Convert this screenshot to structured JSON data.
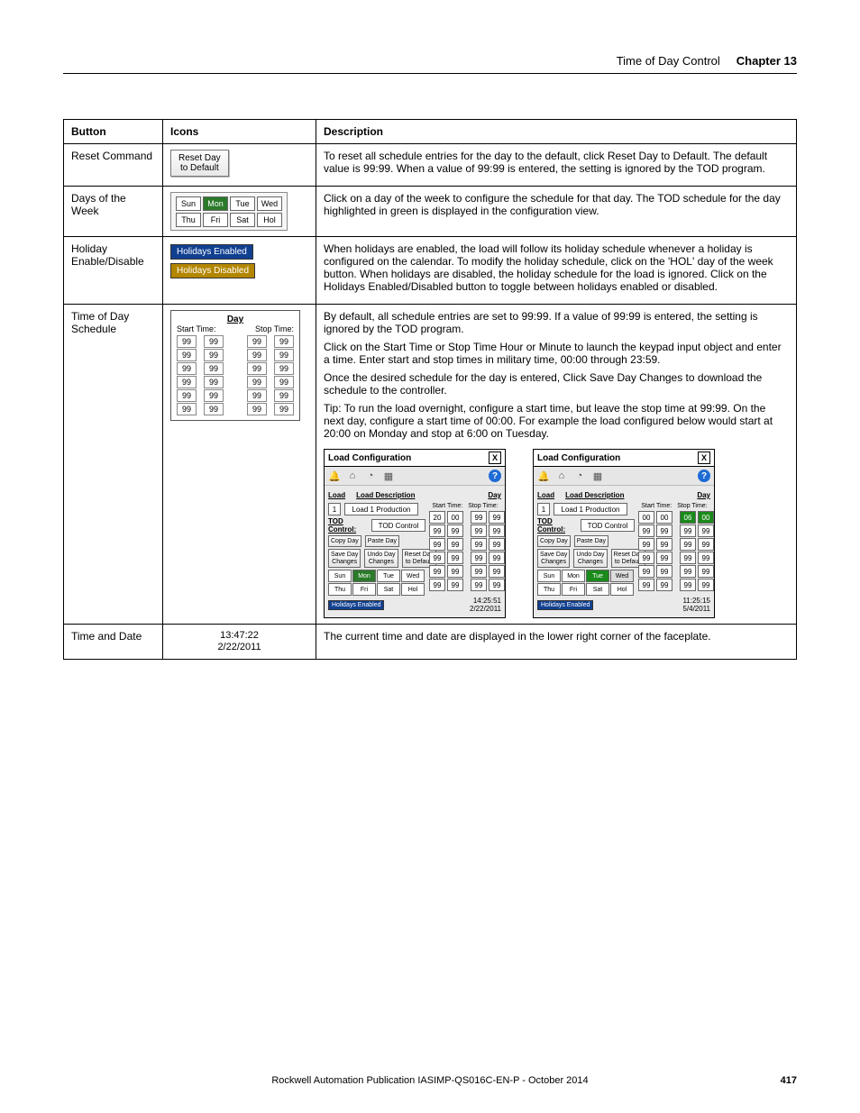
{
  "header": {
    "title": "Time of Day Control",
    "chapter": "Chapter 13"
  },
  "table": {
    "headers": {
      "button": "Button",
      "icons": "Icons",
      "description": "Description"
    }
  },
  "rows": {
    "reset": {
      "button": "Reset Command",
      "icon_label": "Reset Day\nto Default",
      "desc": "To reset all schedule entries for the day to the default, click Reset Day to Default. The default value is 99:99. When a value of 99:99 is entered, the setting is ignored by the TOD program."
    },
    "dow": {
      "button": "Days of the Week",
      "days_row1": [
        "Sun",
        "Mon",
        "Tue",
        "Wed"
      ],
      "days_row2": [
        "Thu",
        "Fri",
        "Sat",
        "Hol"
      ],
      "selected": "Mon",
      "desc": "Click on a day of the week to configure the schedule for that day. The TOD schedule for the day highlighted in green is displayed in the configuration view."
    },
    "hol": {
      "button": "Holiday Enable/Disable",
      "enabled_label": "Holidays Enabled",
      "disabled_label": "Holidays Disabled",
      "desc": "When holidays are enabled, the load will follow its holiday schedule whenever a holiday is configured on the calendar. To modify the holiday schedule, click on the 'HOL' day of the week button. When holidays are disabled, the holiday schedule for the load is ignored. Click on the Holidays Enabled/Disabled button to toggle between holidays enabled or disabled."
    },
    "sched": {
      "button": "Time of Day Schedule",
      "box": {
        "title": "Day",
        "start": "Start Time:",
        "stop": "Stop Time:",
        "rows": 6,
        "cell": "99"
      },
      "desc": [
        "By default, all schedule entries are set to 99:99. If a value of 99:99 is entered, the setting is ignored by the TOD program.",
        "Click on the Start Time or Stop Time Hour or Minute to launch the keypad input object and enter a time. Enter start and stop times in military time, 00:00 through 23:59.",
        "Once the desired schedule for the day is entered, Click Save Day Changes to download the schedule to the controller.",
        "Tip: To run the load overnight, configure a start time, but leave the stop time at 99:99. On the next day, configure a start time of 00:00. For example the load configured below would start at 20:00 on Monday and stop at 6:00 on Tuesday."
      ]
    },
    "timedate": {
      "button": "Time and Date",
      "display": "13:47:22\n2/22/2011",
      "desc": "The current time and date are displayed in the lower right corner of the faceplate."
    }
  },
  "faceplate_common": {
    "title": "Load Configuration",
    "close": "X",
    "load_label": "Load",
    "load_num": "1",
    "load_desc_label": "Load Description",
    "load_desc": "Load 1 Production",
    "tod_control_label": "TOD Control:",
    "tod_control_value": "TOD Control",
    "copy_day": "Copy Day",
    "paste_day": "Paste Day",
    "save_day": "Save Day\nChanges",
    "undo_day": "Undo Day\nChanges",
    "reset_day": "Reset Day\nto Default",
    "holidays_enabled": "Holidays Enabled",
    "day_label": "Day",
    "start_label": "Start Time:",
    "stop_label": "Stop Time:",
    "days": [
      "Sun",
      "Mon",
      "Tue",
      "Wed",
      "Thu",
      "Fri",
      "Sat",
      "Hol"
    ]
  },
  "faceplate1": {
    "selected_day": "Mon",
    "grid": [
      [
        "20",
        "00",
        "99",
        "99"
      ],
      [
        "99",
        "99",
        "99",
        "99"
      ],
      [
        "99",
        "99",
        "99",
        "99"
      ],
      [
        "99",
        "99",
        "99",
        "99"
      ],
      [
        "99",
        "99",
        "99",
        "99"
      ],
      [
        "99",
        "99",
        "99",
        "99"
      ]
    ],
    "timestamp": "14:25:51\n2/22/2011"
  },
  "faceplate2": {
    "selected_day": "Tue",
    "grid": [
      [
        "00",
        "00",
        "06",
        "00"
      ],
      [
        "99",
        "99",
        "99",
        "99"
      ],
      [
        "99",
        "99",
        "99",
        "99"
      ],
      [
        "99",
        "99",
        "99",
        "99"
      ],
      [
        "99",
        "99",
        "99",
        "99"
      ],
      [
        "99",
        "99",
        "99",
        "99"
      ]
    ],
    "highlight_first_row": true,
    "timestamp": "11:25:15\n5/4/2011"
  },
  "footer": {
    "text": "Rockwell Automation Publication IASIMP-QS016C-EN-P - October 2014",
    "page": "417"
  }
}
